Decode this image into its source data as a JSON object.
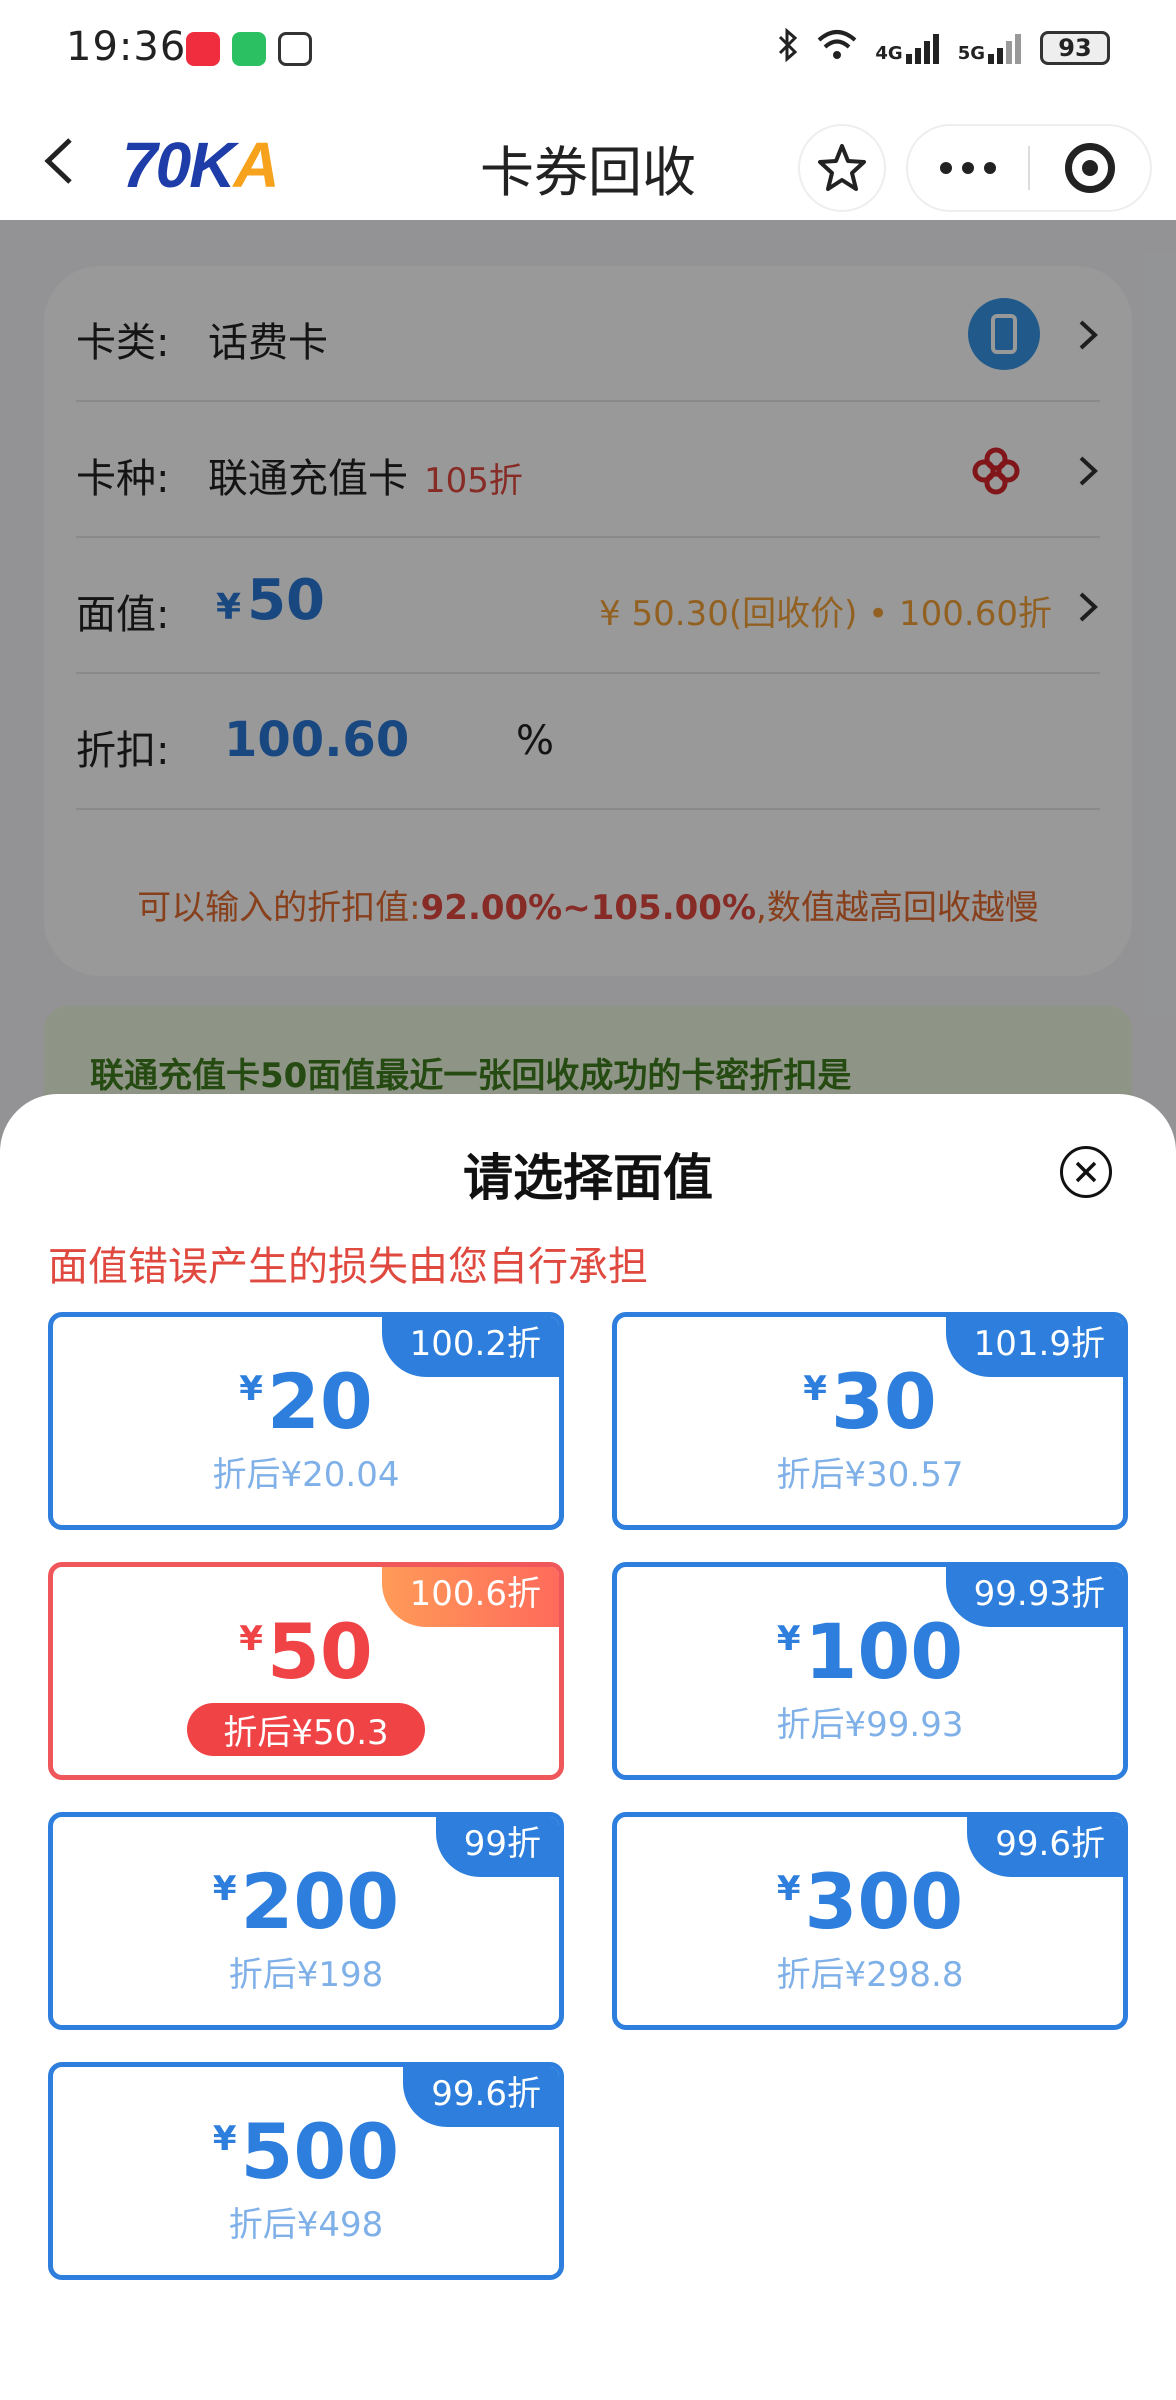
{
  "status": {
    "time": "19:36",
    "net1": "4G",
    "net2": "5G",
    "battery": "93"
  },
  "nav": {
    "logo_part1": "70",
    "logo_part2": "K",
    "logo_part3": "A",
    "title": "卡券回收"
  },
  "form": {
    "card_type_label": "卡类:",
    "card_type_value": "话费卡",
    "card_kind_label": "卡种:",
    "card_kind_value": "联通充值卡",
    "card_kind_tag": "105折",
    "face_label": "面值:",
    "face_currency": "¥",
    "face_value": "50",
    "face_recycle": "¥ 50.30(回收价) • 100.60折",
    "discount_label": "折扣:",
    "discount_value": "100.60",
    "discount_unit": "%",
    "hint_prefix": "可以输入的折扣值:",
    "hint_range": "92.00%~105.00%",
    "hint_suffix": ",数值越高回收越慢"
  },
  "tip": {
    "text": "联通充值卡50面值最近一张回收成功的卡密折扣是"
  },
  "sheet": {
    "title": "请选择面值",
    "warning": "面值错误产生的损失由您自行承担",
    "currency": "¥",
    "options": [
      {
        "badge": "100.2折",
        "amount": "20",
        "after": "折后¥20.04"
      },
      {
        "badge": "101.9折",
        "amount": "30",
        "after": "折后¥30.57"
      },
      {
        "badge": "100.6折",
        "amount": "50",
        "after": "折后¥50.3"
      },
      {
        "badge": "99.93折",
        "amount": "100",
        "after": "折后¥99.93"
      },
      {
        "badge": "99折",
        "amount": "200",
        "after": "折后¥198"
      },
      {
        "badge": "99.6折",
        "amount": "300",
        "after": "折后¥298.8"
      },
      {
        "badge": "99.6折",
        "amount": "500",
        "after": "折后¥498"
      }
    ]
  },
  "colors": {
    "accent": "#2e7fdd",
    "selected": "#ef4346",
    "warning": "#e0493f"
  }
}
